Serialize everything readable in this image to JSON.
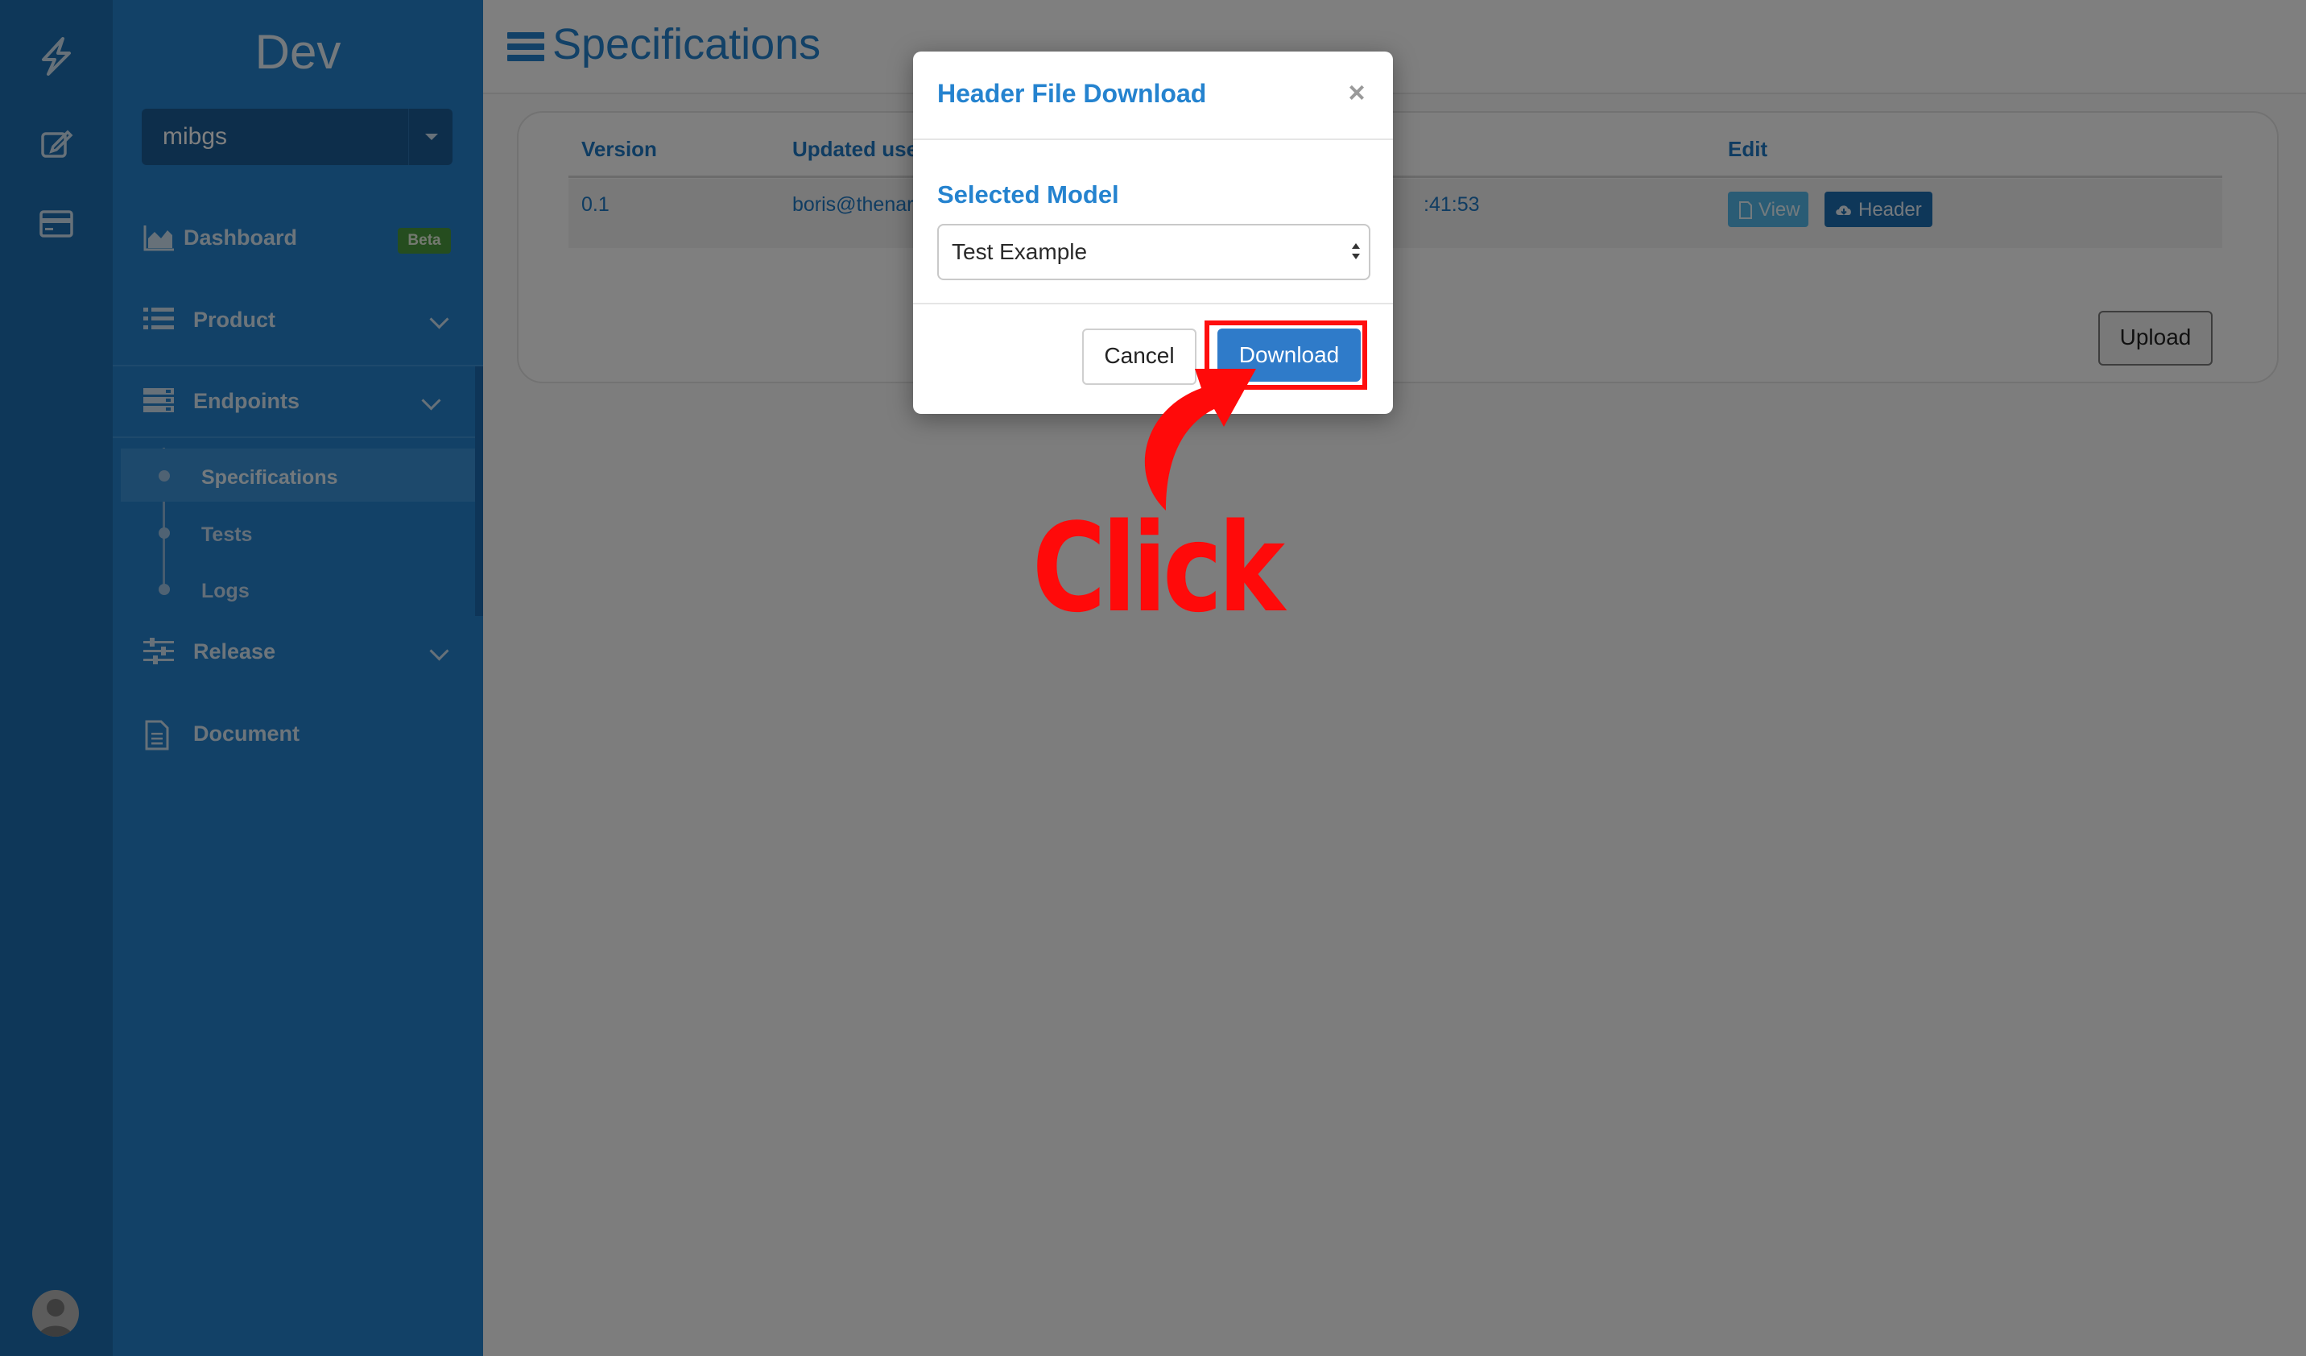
{
  "sidebar": {
    "brand": "Dev",
    "project": "mibgs",
    "items": [
      {
        "label": "Dashboard",
        "badge": "Beta"
      },
      {
        "label": "Product"
      },
      {
        "label": "Endpoints"
      },
      {
        "label": "Release"
      },
      {
        "label": "Document"
      }
    ],
    "subitems": [
      {
        "label": "Specifications"
      },
      {
        "label": "Tests"
      },
      {
        "label": "Logs"
      }
    ]
  },
  "page": {
    "title": "Specifications"
  },
  "table": {
    "headers": [
      "Version",
      "Updated use",
      "Edit"
    ],
    "rows": [
      {
        "version": "0.1",
        "user": "boris@thenar",
        "time": ":41:53"
      }
    ],
    "view_label": "View",
    "header_label": "Header"
  },
  "upload_label": "Upload",
  "modal": {
    "title": "Header File Download",
    "close": "×",
    "field_label": "Selected Model",
    "selected_model": "Test Example",
    "cancel_label": "Cancel",
    "download_label": "Download"
  },
  "annotation": {
    "text": "Click",
    "color": "#ff0a0a"
  },
  "colors": {
    "primary": "#2583cf",
    "sidebar": "#2583cf",
    "rail": "#1d6fb3"
  }
}
